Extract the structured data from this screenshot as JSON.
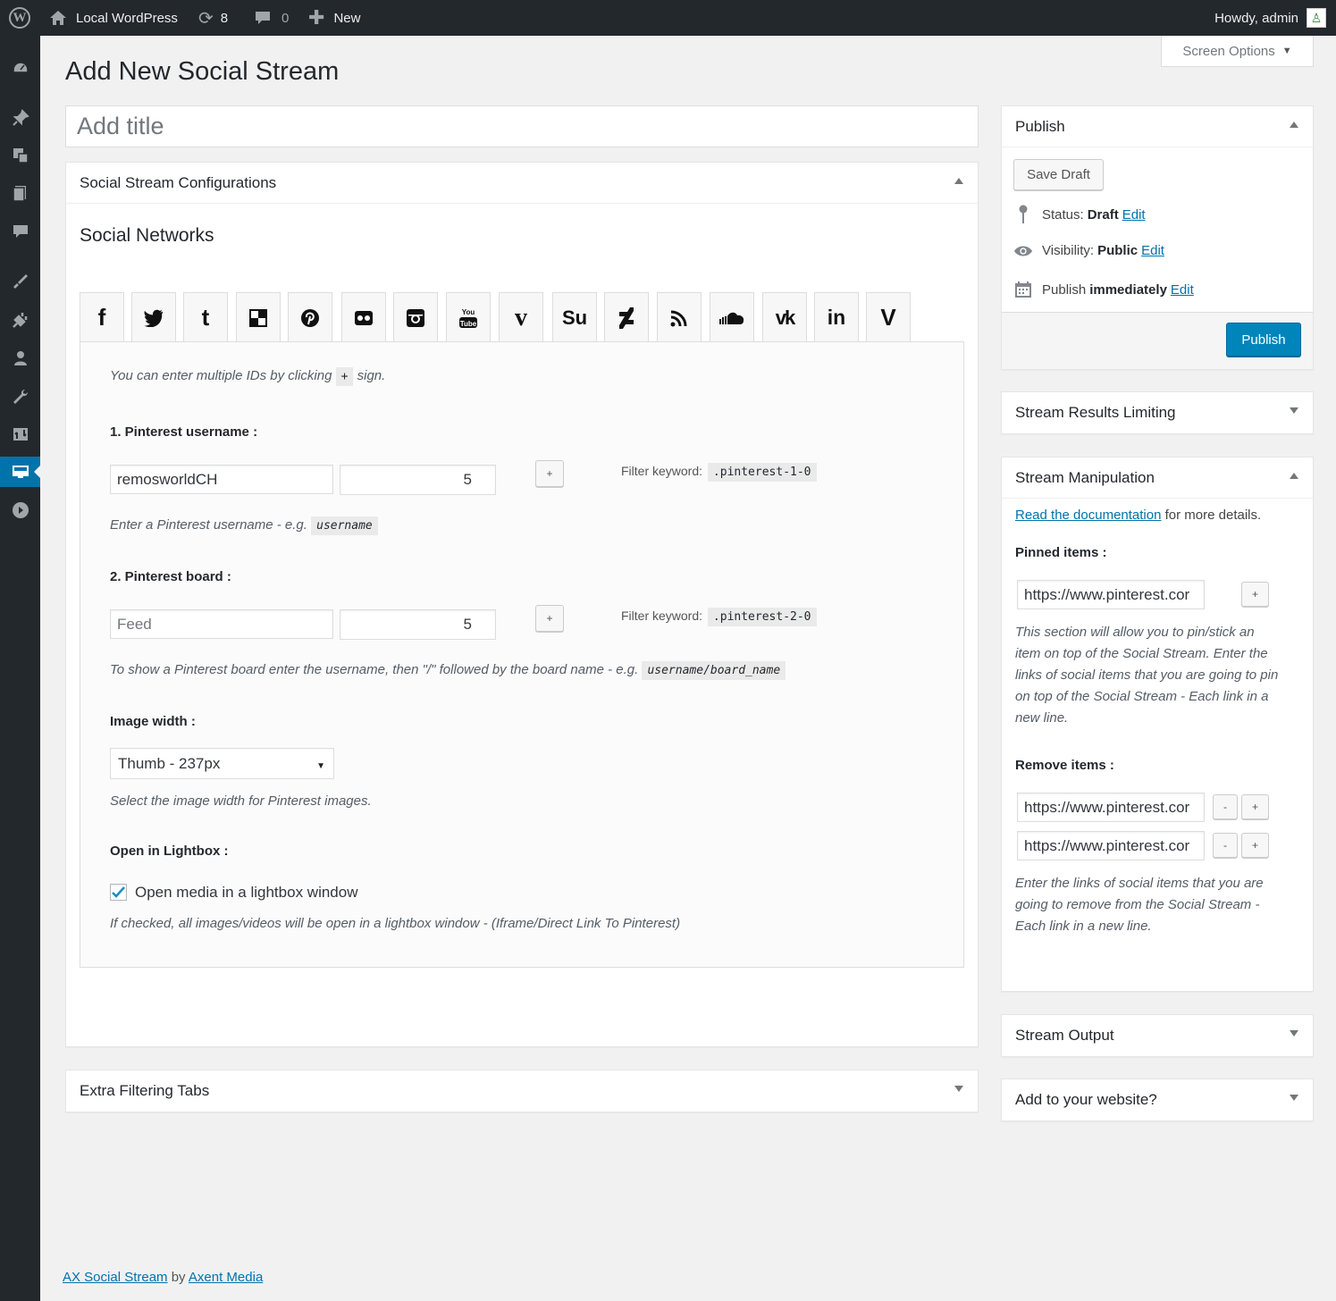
{
  "admin_bar": {
    "site_name": "Local WordPress",
    "updates_count": "8",
    "comments_count": "0",
    "new_label": "New",
    "greeting": "Howdy, admin"
  },
  "sidebar": {
    "items": [
      {
        "name": "dashboard-icon"
      },
      {
        "name": "posts-icon"
      },
      {
        "name": "media-icon"
      },
      {
        "name": "pages-icon"
      },
      {
        "name": "comments-icon"
      },
      {
        "name": "appearance-icon"
      },
      {
        "name": "plugins-icon"
      },
      {
        "name": "users-icon"
      },
      {
        "name": "tools-icon"
      },
      {
        "name": "settings-icon"
      },
      {
        "name": "social-stream-icon",
        "current": true
      },
      {
        "name": "collapse-menu-icon"
      }
    ]
  },
  "page": {
    "title": "Add New Social Stream",
    "screen_options": "Screen Options",
    "title_placeholder": "Add title"
  },
  "config_box": {
    "heading": "Social Stream Configurations",
    "section_title": "Social Networks",
    "networks": [
      {
        "name": "facebook",
        "glyph": "f"
      },
      {
        "name": "twitter",
        "glyph": "🐦"
      },
      {
        "name": "tumblr",
        "glyph": "t"
      },
      {
        "name": "delicious",
        "glyph": "◧"
      },
      {
        "name": "pinterest",
        "glyph": "℗"
      },
      {
        "name": "flickr",
        "glyph": "●●"
      },
      {
        "name": "instagram",
        "glyph": "◙"
      },
      {
        "name": "youtube",
        "glyph": "You Tube"
      },
      {
        "name": "vimeo",
        "glyph": "v"
      },
      {
        "name": "stumbleupon",
        "glyph": "Su"
      },
      {
        "name": "deviantart",
        "glyph": "ƒ"
      },
      {
        "name": "rss",
        "glyph": "◠"
      },
      {
        "name": "soundcloud",
        "glyph": "☁"
      },
      {
        "name": "vk",
        "glyph": "vk"
      },
      {
        "name": "linkedin",
        "glyph": "in"
      },
      {
        "name": "vine",
        "glyph": "V"
      }
    ],
    "hint_before": "You can enter multiple IDs by clicking",
    "hint_plus": "+",
    "hint_after": "sign.",
    "field1": {
      "label": "1. Pinterest username",
      "value": "remosworldCH",
      "count": "5",
      "add": "+",
      "filter_label": "Filter keyword:",
      "filter_value": ".pinterest-1-0",
      "help": "Enter a Pinterest username - e.g.",
      "help_code": "username"
    },
    "field2": {
      "label": "2. Pinterest board",
      "placeholder": "Feed",
      "count": "5",
      "add": "+",
      "filter_label": "Filter keyword:",
      "filter_value": ".pinterest-2-0",
      "help": "To show a Pinterest board enter the username, then \"/\" followed by the board name - e.g.",
      "help_code": "username/board_name"
    },
    "image_width": {
      "label": "Image width",
      "selected": "Thumb - 237px",
      "help": "Select the image width for Pinterest images."
    },
    "lightbox": {
      "label": "Open in Lightbox",
      "checkbox_label": "Open media in a lightbox window",
      "checked": true,
      "help": "If checked, all images/videos will be open in a lightbox window - (Iframe/Direct Link To Pinterest)"
    }
  },
  "extra_box": {
    "heading": "Extra Filtering Tabs"
  },
  "publish_box": {
    "heading": "Publish",
    "save_draft": "Save Draft",
    "status_label": "Status:",
    "status_value": "Draft",
    "visibility_label": "Visibility:",
    "visibility_value": "Public",
    "publish_label": "Publish",
    "publish_value": "immediately",
    "edit": "Edit",
    "publish_button": "Publish"
  },
  "limit_box": {
    "heading": "Stream Results Limiting"
  },
  "manip_box": {
    "heading": "Stream Manipulation",
    "doc_link": "Read the documentation",
    "doc_after": "for more details.",
    "pinned_label": "Pinned items",
    "pinned_value": "https://www.pinterest.cor",
    "add": "+",
    "remove": "-",
    "pinned_help": [
      "This section will allow you to pin/stick an",
      "item on top of the Social Stream. Enter the",
      "links of social items that you are going to pin",
      "on top of the Social Stream - Each link in a",
      "new line."
    ],
    "remove_label": "Remove items",
    "remove_values": [
      "https://www.pinterest.cor",
      "https://www.pinterest.cor"
    ],
    "remove_help": [
      "Enter the links of social items that you are",
      "going to remove from the Social Stream -",
      "Each link in a new line."
    ]
  },
  "output_box": {
    "heading": "Stream Output"
  },
  "website_box": {
    "heading": "Add to your website?"
  },
  "footer": {
    "plugin": "AX Social Stream",
    "by": "by",
    "author": "Axent Media"
  },
  "colors": {
    "primary": "#0085ba",
    "admin_bar": "#23282d",
    "link": "#0073aa"
  }
}
